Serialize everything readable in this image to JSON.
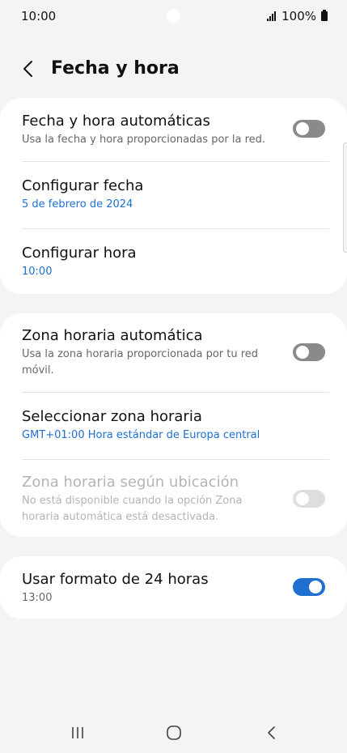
{
  "status_bar": {
    "time": "10:00",
    "battery": "100%"
  },
  "header": {
    "title": "Fecha y hora"
  },
  "card1": {
    "auto_datetime": {
      "title": "Fecha y hora automáticas",
      "subtitle": "Usa la fecha y hora proporcionadas por la red.",
      "toggle": "off"
    },
    "set_date": {
      "title": "Configurar fecha",
      "value": "5 de febrero de 2024"
    },
    "set_time": {
      "title": "Configurar hora",
      "value": "10:00"
    }
  },
  "card2": {
    "auto_timezone": {
      "title": "Zona horaria automática",
      "subtitle_line1": "Usa la zona horaria proporcionada por tu red",
      "subtitle_line2": "móvil.",
      "toggle": "off"
    },
    "select_timezone": {
      "title": "Seleccionar zona horaria",
      "value": "GMT+01:00 Hora estándar de Europa central"
    },
    "location_timezone": {
      "title": "Zona horaria según ubicación",
      "subtitle_line1": "No está disponible cuando la opción Zona",
      "subtitle_line2": "horaria automática está desactivada.",
      "toggle": "disabled-off"
    }
  },
  "card3": {
    "format_24h": {
      "title": "Usar formato de 24 horas",
      "value": "13:00",
      "toggle": "on"
    }
  },
  "colors": {
    "accent": "#1f6fd1",
    "background": "#f4f4f6",
    "card": "#ffffff"
  }
}
